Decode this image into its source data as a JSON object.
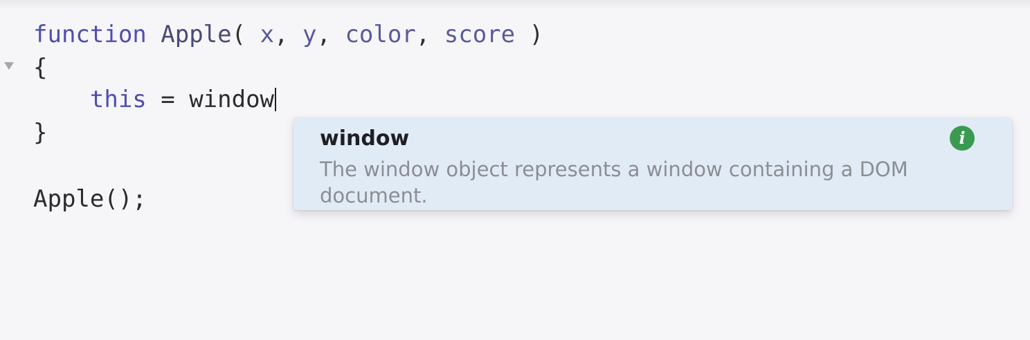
{
  "editor": {
    "line1": {
      "kw": "function",
      "name": "Apple",
      "open": "( ",
      "p1": "x",
      "c1": ", ",
      "p2": "y",
      "c2": ", ",
      "p3": "color",
      "c3": ", ",
      "p4": "score",
      "close": " )"
    },
    "line2": "{",
    "line3": {
      "indent": "    ",
      "kw": "this",
      "op": " = ",
      "ident": "window"
    },
    "line4": "}",
    "line6": "Apple();"
  },
  "autocomplete": {
    "title": "window",
    "description": "The window object represents a window containing a DOM document.",
    "info_icon_glyph": "i",
    "info_icon": "info-icon",
    "accent_color": "#3a9a4f",
    "background_color": "#e1ebf6"
  }
}
